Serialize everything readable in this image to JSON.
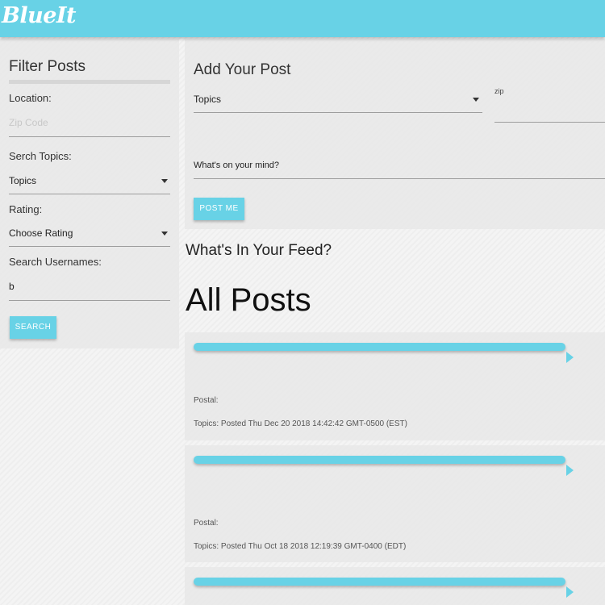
{
  "app": {
    "brand": "BlueIt"
  },
  "filter": {
    "title": "Filter Posts",
    "location_label": "Location:",
    "zip_placeholder": "Zip Code",
    "topics_label": "Serch Topics:",
    "topics_value": "Topics",
    "rating_label": "Rating:",
    "rating_value": "Choose Rating",
    "usernames_label": "Search Usernames:",
    "usernames_value": "b",
    "search_button": "SEARCH"
  },
  "add_post": {
    "title": "Add Your Post",
    "topics_value": "Topics",
    "zip_label": "zip",
    "mind_placeholder": "What's on your mind?",
    "post_button": "POST ME"
  },
  "feed": {
    "title": "What's In Your Feed?",
    "heading": "All Posts",
    "posts": [
      {
        "postal": "Postal:",
        "topics_line": "Topics: Posted Thu Dec 20 2018 14:42:42 GMT-0500 (EST)"
      },
      {
        "postal": "Postal:",
        "topics_line": "Topics: Posted Thu Oct 18 2018 12:19:39 GMT-0400 (EDT)"
      },
      {
        "postal": "",
        "topics_line": ""
      }
    ]
  },
  "colors": {
    "accent": "#68d2e6",
    "panel": "#e8e8e8"
  }
}
